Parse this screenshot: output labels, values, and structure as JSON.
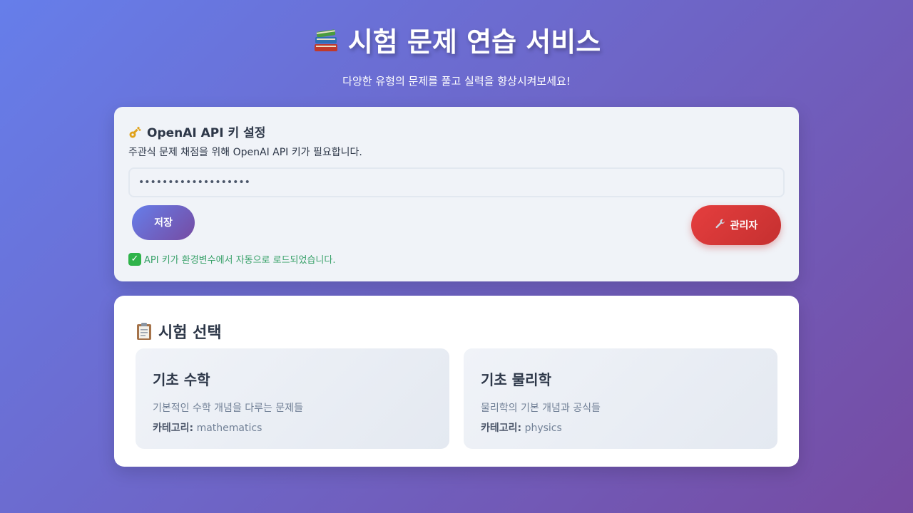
{
  "header": {
    "title": "시험 문제 연습 서비스",
    "subtitle": "다양한 유형의 문제를 풀고 실력을 향상시켜보세요!",
    "icon": "books-icon"
  },
  "api_settings": {
    "title": "OpenAI API 키 설정",
    "title_icon": "key-icon",
    "description": "주관식 문제 채점을 위해 OpenAI API 키가 필요합니다.",
    "input_value": "•••••••••••••••••••",
    "save_label": "저장",
    "admin_label": "관리자",
    "admin_icon": "wrench-icon",
    "status_text": "API 키가 환경변수에서 자동으로 로드되었습니다.",
    "status_icon": "check-icon",
    "status_color": "#38a169"
  },
  "exam_selection": {
    "title": "시험 선택",
    "title_icon": "clipboard-icon",
    "category_label": "카테고리:",
    "exams": [
      {
        "name": "기초 수학",
        "description": "기본적인 수학 개념을 다루는 문제들",
        "category": "mathematics"
      },
      {
        "name": "기초 물리학",
        "description": "물리학의 기본 개념과 공식들",
        "category": "physics"
      }
    ]
  },
  "colors": {
    "background_start": "#667eea",
    "background_end": "#764ba2",
    "admin_red": "#e53e3e",
    "success_green": "#38a169"
  }
}
